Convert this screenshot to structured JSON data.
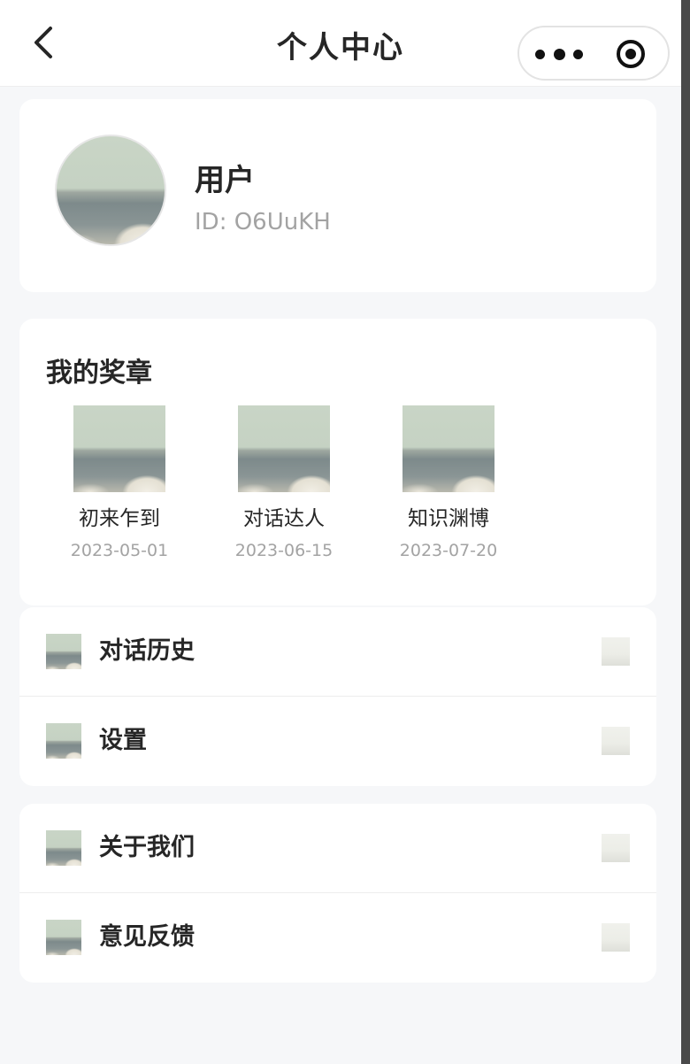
{
  "navbar": {
    "title": "个人中心",
    "back_icon": "chevron-left-icon",
    "more_icon": "more-dots-icon",
    "close_icon": "capsule-close-icon"
  },
  "profile": {
    "name": "用户",
    "id_text": "ID: O6UuKH"
  },
  "medals": {
    "title": "我的奖章",
    "items": [
      {
        "name": "初来乍到",
        "date": "2023-05-01"
      },
      {
        "name": "对话达人",
        "date": "2023-06-15"
      },
      {
        "name": "知识渊博",
        "date": "2023-07-20"
      }
    ]
  },
  "menu": {
    "group1": [
      {
        "label": "对话历史"
      },
      {
        "label": "设置"
      }
    ],
    "group2": [
      {
        "label": "关于我们"
      },
      {
        "label": "意见反馈"
      }
    ]
  },
  "colors": {
    "background": "#f6f7f9",
    "card": "#ffffff",
    "text": "#262626",
    "muted": "#a3a3a3"
  }
}
